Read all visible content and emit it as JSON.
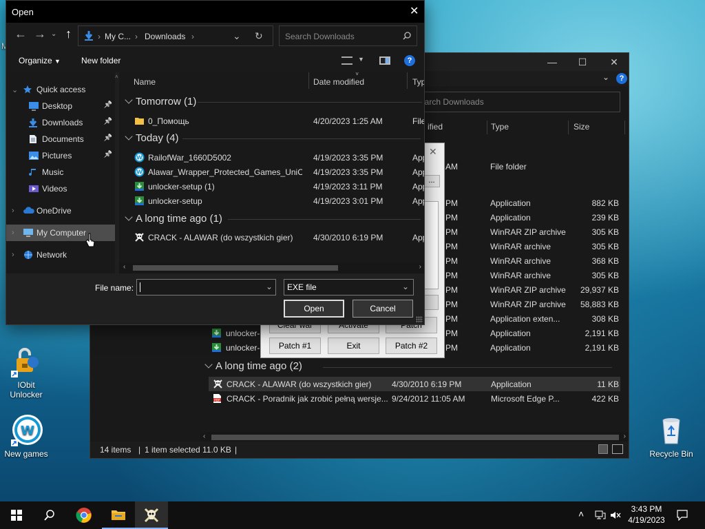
{
  "desktop": {
    "icons": [
      {
        "label": "IObit Unlocker"
      },
      {
        "label": "New games"
      },
      {
        "label": "Recycle Bin"
      }
    ],
    "edge_letter": "M"
  },
  "background_window": {
    "search_placeholder": "Search Downloads",
    "columns": {
      "modified": "ified",
      "type": "Type",
      "size": "Size"
    },
    "rows": [
      {
        "date": "AM",
        "type": "File folder",
        "size": ""
      },
      {
        "date": "PM",
        "type": "Application",
        "size": "882 KB"
      },
      {
        "date": "PM",
        "type": "Application",
        "size": "239 KB"
      },
      {
        "date": "PM",
        "type": "WinRAR ZIP archive",
        "size": "305 KB"
      },
      {
        "date": "PM",
        "type": "WinRAR archive",
        "size": "305 KB"
      },
      {
        "date": "PM",
        "type": "WinRAR archive",
        "size": "368 KB"
      },
      {
        "date": "PM",
        "type": "WinRAR archive",
        "size": "305 KB"
      },
      {
        "date": "PM",
        "type": "WinRAR ZIP archive",
        "size": "29,937 KB"
      },
      {
        "date": "PM",
        "type": "WinRAR ZIP archive",
        "size": "58,883 KB"
      },
      {
        "date": "PM",
        "type": "Application exten...",
        "size": "308 KB"
      },
      {
        "date": "PM",
        "type": "Application",
        "size": "2,191 KB",
        "name": "unlocker-"
      },
      {
        "date": "PM",
        "type": "Application",
        "size": "2,191 KB",
        "name": "unlocker-"
      }
    ],
    "group_long_ago": "A long time ago (2)",
    "long_ago_rows": [
      {
        "name": "CRACK - ALAWAR (do wszystkich gier)",
        "date": "4/30/2010 6:19 PM",
        "type": "Application",
        "size": "11 KB"
      },
      {
        "name": "CRACK - Poradnik jak zrobić pełną wersje...",
        "date": "9/24/2012 11:05 AM",
        "type": "Microsoft Edge P...",
        "size": "422 KB"
      }
    ],
    "status": {
      "items": "14 items",
      "selected": "1 item selected  11.0 KB",
      "sep": "|"
    }
  },
  "crack_dialog": {
    "buttons": {
      "clear_war": "Clear war",
      "activate": "Activate",
      "patch": "Patch",
      "patch1": "Patch #1",
      "exit": "Exit",
      "patch2": "Patch #2"
    },
    "dots": "..."
  },
  "open_dialog": {
    "title": "Open",
    "breadcrumb": [
      "My C...",
      "Downloads"
    ],
    "search_placeholder": "Search Downloads",
    "toolbar": {
      "organize": "Organize",
      "new_folder": "New folder"
    },
    "tree": [
      {
        "label": "Quick access",
        "pinned": false
      },
      {
        "label": "Desktop",
        "pinned": true
      },
      {
        "label": "Downloads",
        "pinned": true
      },
      {
        "label": "Documents",
        "pinned": true
      },
      {
        "label": "Pictures",
        "pinned": true
      },
      {
        "label": "Music",
        "pinned": false
      },
      {
        "label": "Videos",
        "pinned": false
      },
      {
        "label": "OneDrive",
        "pinned": false
      },
      {
        "label": "My Computer",
        "pinned": false
      },
      {
        "label": "Network",
        "pinned": false
      }
    ],
    "columns": {
      "name": "Name",
      "date": "Date modified",
      "type": "Type"
    },
    "groups": [
      {
        "title": "Tomorrow (1)",
        "rows": [
          {
            "name": "0_Помощь",
            "date": "4/20/2023 1:25 AM",
            "type": "File fo"
          }
        ]
      },
      {
        "title": "Today (4)",
        "rows": [
          {
            "name": "RailofWar_1660D5002",
            "date": "4/19/2023 3:35 PM",
            "type": "Appli"
          },
          {
            "name": "Alawar_Wrapper_Protected_Games_UniC...",
            "date": "4/19/2023 3:35 PM",
            "type": "Appli"
          },
          {
            "name": "unlocker-setup (1)",
            "date": "4/19/2023 3:11 PM",
            "type": "Appli"
          },
          {
            "name": "unlocker-setup",
            "date": "4/19/2023 3:01 PM",
            "type": "Appli"
          }
        ]
      },
      {
        "title": "A long time ago (1)",
        "rows": [
          {
            "name": "CRACK - ALAWAR (do wszystkich gier)",
            "date": "4/30/2010 6:19 PM",
            "type": "Appli"
          }
        ]
      }
    ],
    "file_name_label": "File name:",
    "file_name_value": "",
    "file_type": "EXE file",
    "open_label": "Open",
    "cancel_label": "Cancel"
  },
  "taskbar": {
    "time": "3:43 PM",
    "date": "4/19/2023"
  },
  "colors": {
    "accent": "#1e6fd9",
    "folder": "#f3c046",
    "selection": "#4d4d4d"
  }
}
